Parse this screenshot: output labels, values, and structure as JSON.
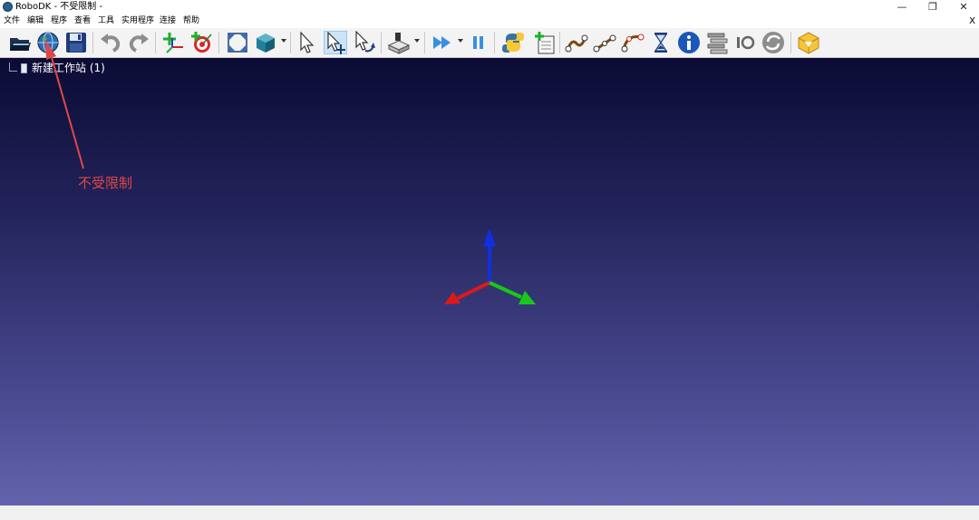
{
  "window": {
    "title": "RoboDK - 不受限制 -",
    "minimize_glyph": "—",
    "restore_glyph": "❐",
    "close_glyph": "✕"
  },
  "menu": {
    "items": [
      "文件",
      "编辑",
      "程序",
      "查看",
      "工具",
      "实用程序",
      "连接",
      "帮助"
    ],
    "close_label": "X"
  },
  "tree": {
    "station_label": "新建工作站 (1)"
  },
  "annotation": {
    "text": "不受限制",
    "color": "#e04848"
  },
  "axes": {
    "x_color": "#e01818",
    "y_color": "#18c818",
    "z_color": "#1030e0"
  },
  "toolbar_icons": [
    "open-icon",
    "globe-library-icon",
    "save-icon",
    "undo-icon",
    "redo-icon",
    "add-reference-frame-icon",
    "add-target-icon",
    "fit-all-icon",
    "view-cube-icon",
    "select-icon",
    "select-move-icon",
    "select-rotate-icon",
    "tool-cad-icon",
    "run-program-icon",
    "pause-icon",
    "python-program-icon",
    "add-program-icon",
    "move-joint-icon",
    "move-linear-icon",
    "move-circular-icon",
    "pause-wait-icon",
    "info-icon",
    "set-speed-icon",
    "io-icon",
    "reload-icon",
    "settings-box-icon"
  ]
}
